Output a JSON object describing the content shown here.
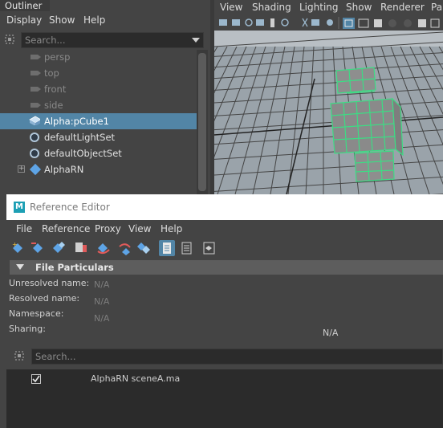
{
  "outliner": {
    "title": "Outliner",
    "menu": [
      "Display",
      "Show",
      "Help"
    ],
    "search_placeholder": "Search...",
    "items": [
      {
        "label": "persp",
        "icon": "camera-icon",
        "dimmed": true
      },
      {
        "label": "top",
        "icon": "camera-icon",
        "dimmed": true
      },
      {
        "label": "front",
        "icon": "camera-icon",
        "dimmed": true
      },
      {
        "label": "side",
        "icon": "camera-icon",
        "dimmed": true
      },
      {
        "label": "Alpha:pCube1",
        "icon": "mesh-icon",
        "selected": true
      },
      {
        "label": "defaultLightSet",
        "icon": "set-icon"
      },
      {
        "label": "defaultObjectSet",
        "icon": "set-icon"
      },
      {
        "label": "AlphaRN",
        "icon": "reference-node-icon",
        "expandable": true
      }
    ]
  },
  "viewport": {
    "menu": [
      "View",
      "Shading",
      "Lighting",
      "Show",
      "Renderer",
      "Pa"
    ],
    "background_color": "#9aa3aa",
    "wireframe_color": "#3ddc84"
  },
  "reference_editor": {
    "title": "Reference Editor",
    "menu": [
      "File",
      "Reference",
      "Proxy",
      "View",
      "Help"
    ],
    "section_title": "File Particulars",
    "fields": [
      {
        "label": "Unresolved name:",
        "value": "N/A"
      },
      {
        "label": "Resolved name:",
        "value": "N/A"
      },
      {
        "label": "Namespace:",
        "value": "N/A"
      },
      {
        "label": "Sharing:",
        "value": "N/A"
      }
    ],
    "search_placeholder": "Search...",
    "references": [
      {
        "checked": true,
        "label": "AlphaRN sceneA.ma"
      }
    ]
  },
  "colors": {
    "selection": "#5285a6",
    "panel": "#444444",
    "field": "#2b2b2b"
  }
}
